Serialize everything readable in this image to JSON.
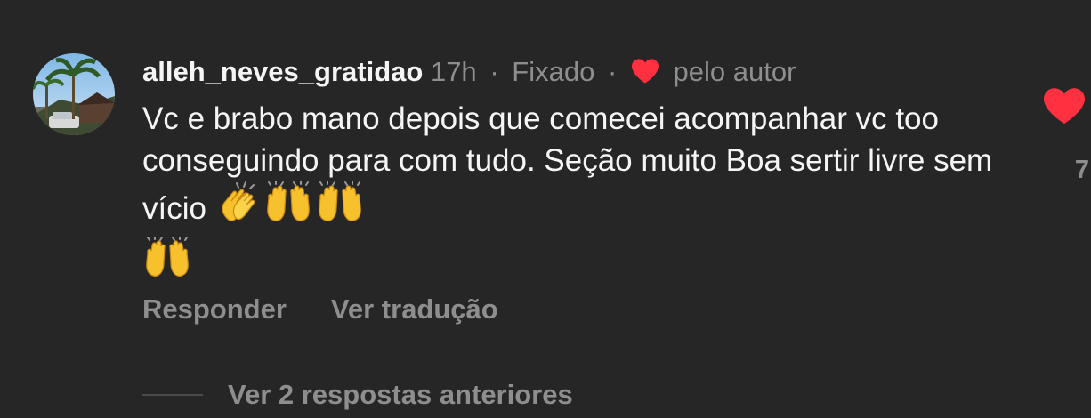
{
  "comment": {
    "username": "alleh_neves_gratidao",
    "time": "17h",
    "separator": "·",
    "pinned": "Fixado",
    "liked_by": "pelo autor",
    "text": "Vc e brabo mano depois que comecei acompanhar vc too conseguindo para com tudo. Seção muito Boa sertir livre sem vício",
    "emojis": [
      "👏",
      "🙌",
      "🙌",
      "🙌"
    ],
    "like_count": "7",
    "heart_color": "#ff3040"
  },
  "actions": {
    "reply": "Responder",
    "translate": "Ver tradução"
  },
  "replies": {
    "label": "Ver 2 respostas anteriores"
  }
}
